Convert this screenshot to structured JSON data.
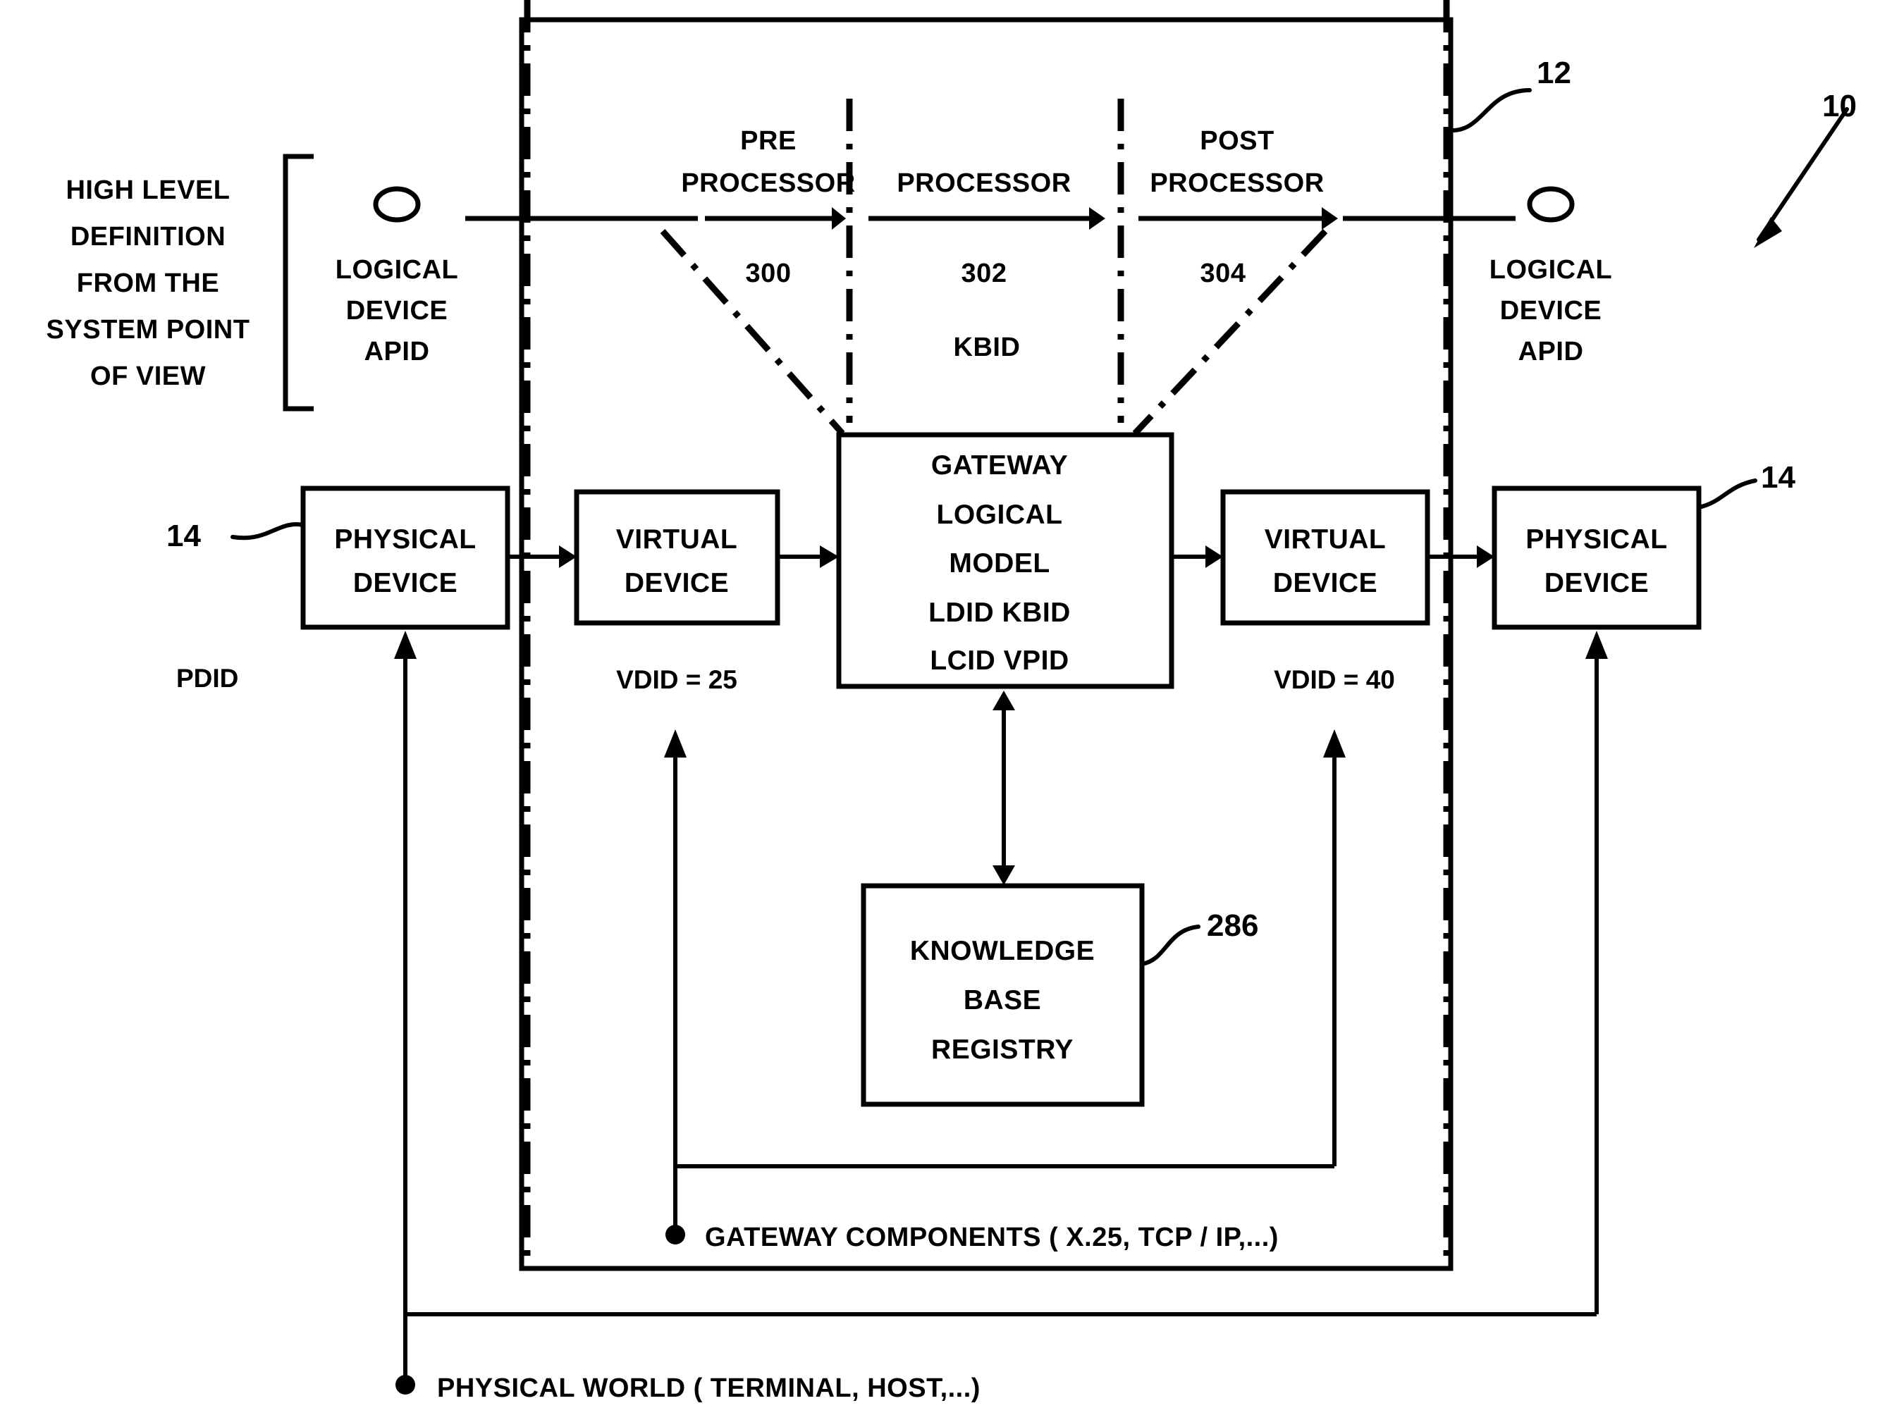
{
  "figure": {
    "title": "Gateway logical model block diagram",
    "reference_numerals": {
      "system": "10",
      "gateway_boundary": "12",
      "physical_device_left": "14",
      "physical_device_right": "14",
      "knowledge_base_registry": "286",
      "pre_processor": "300",
      "processor": "302",
      "post_processor": "304"
    },
    "left_annotation": {
      "lines": [
        "HIGH LEVEL",
        "DEFINITION",
        "FROM THE",
        "SYSTEM POINT",
        "OF VIEW"
      ]
    },
    "logical_device_left": {
      "lines": [
        "LOGICAL",
        "DEVICE",
        "APID"
      ]
    },
    "logical_device_right": {
      "lines": [
        "LOGICAL",
        "DEVICE",
        "APID"
      ]
    },
    "pipeline": [
      {
        "name": "PRE PROCESSOR",
        "line1": "PRE",
        "line2": "PROCESSOR",
        "numeral": "300"
      },
      {
        "name": "PROCESSOR",
        "line1": "",
        "line2": "PROCESSOR",
        "numeral": "302"
      },
      {
        "name": "POST PROCESSOR",
        "line1": "POST",
        "line2": "PROCESSOR",
        "numeral": "304"
      }
    ],
    "kbid_label": "KBID",
    "boxes": {
      "physical_device_left": {
        "lines": [
          "PHYSICAL",
          "DEVICE"
        ],
        "id_label": "PDID"
      },
      "virtual_device_left": {
        "lines": [
          "VIRTUAL",
          "DEVICE"
        ],
        "id_label": "VDID = 25"
      },
      "gateway_logical_model": {
        "lines": [
          "GATEWAY",
          "LOGICAL",
          "MODEL",
          "LDID KBID",
          "LCID VPID"
        ]
      },
      "virtual_device_right": {
        "lines": [
          "VIRTUAL",
          "DEVICE"
        ],
        "id_label": "VDID = 40"
      },
      "physical_device_right": {
        "lines": [
          "PHYSICAL",
          "DEVICE"
        ]
      },
      "knowledge_base_registry": {
        "lines": [
          "KNOWLEDGE",
          "BASE",
          "REGISTRY"
        ]
      }
    },
    "captions": {
      "gateway_components": "GATEWAY COMPONENTS ( X.25, TCP / IP,...)",
      "physical_world": "PHYSICAL WORLD ( TERMINAL, HOST,...)"
    },
    "colors": {
      "ink": "#000000",
      "paper": "#ffffff"
    }
  }
}
